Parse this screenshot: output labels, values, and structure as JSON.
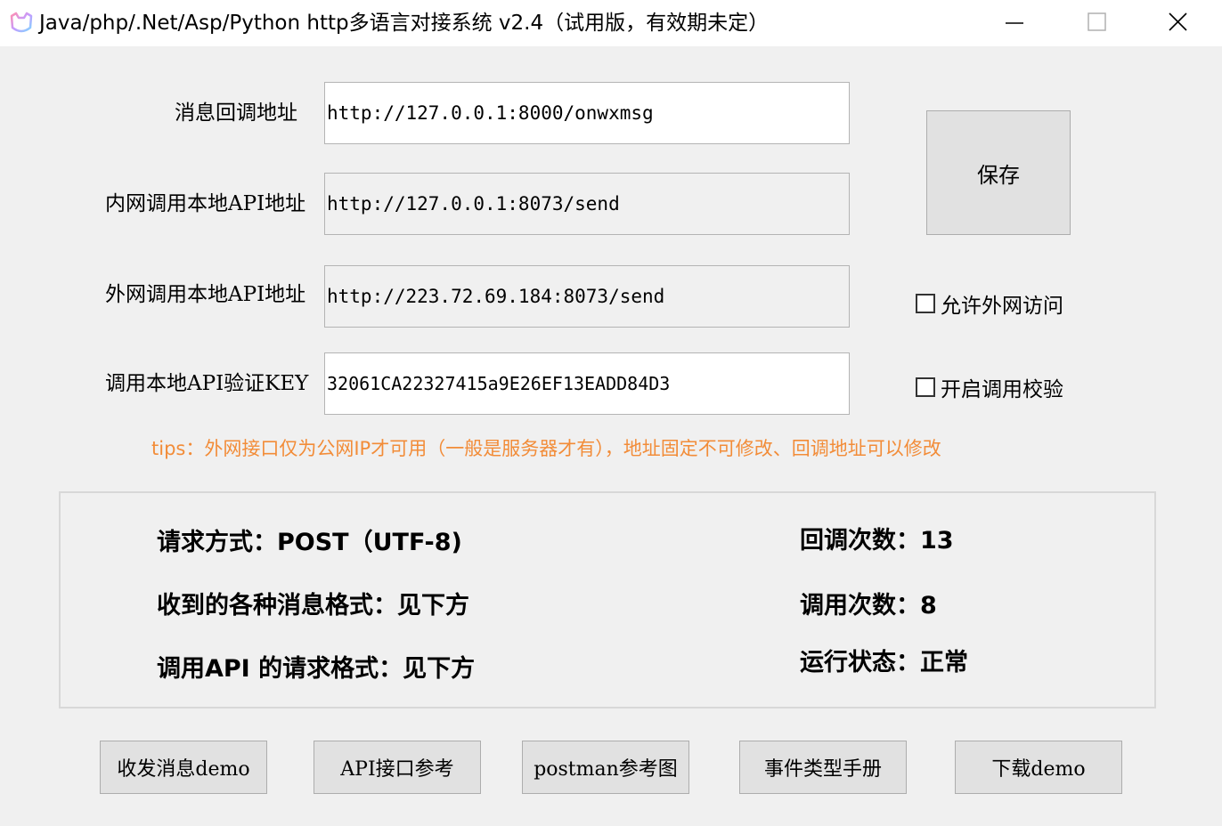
{
  "window": {
    "title": "Java/php/.Net/Asp/Python http多语言对接系统 v2.4（试用版，有效期未定）"
  },
  "form": {
    "callback_label": "消息回调地址",
    "callback_value": "http://127.0.0.1:8000/onwxmsg",
    "intranet_label": "内网调用本地API地址",
    "intranet_value": "http://127.0.0.1:8073/send",
    "extranet_label": "外网调用本地API地址",
    "extranet_value": "http://223.72.69.184:8073/send",
    "key_label": "调用本地API验证KEY",
    "key_value": "32061CA22327415a9E26EF13EADD84D3"
  },
  "save_label": "保存",
  "checkboxes": {
    "allow_extranet": {
      "label": "允许外网访问",
      "checked": false
    },
    "enable_verify": {
      "label": "开启调用校验",
      "checked": false
    }
  },
  "tips": "tips：外网接口仅为公网IP才可用（一般是服务器才有），地址固定不可修改、回调地址可以修改",
  "info": {
    "request_method": "请求方式：POST（UTF-8)",
    "message_format": "收到的各种消息格式：见下方",
    "api_format": "调用API 的请求格式：见下方",
    "callback_count": "回调次数：13",
    "call_count": "调用次数：8",
    "status": "运行状态：正常"
  },
  "buttons": {
    "demo_msg": "收发消息demo",
    "api_ref": "API接口参考",
    "postman_ref": "postman参考图",
    "event_manual": "事件类型手册",
    "download_demo": "下载demo"
  },
  "colors": {
    "tips": "#f28c38",
    "window_bg": "#f0f0f0",
    "button_bg": "#e1e1e1"
  }
}
